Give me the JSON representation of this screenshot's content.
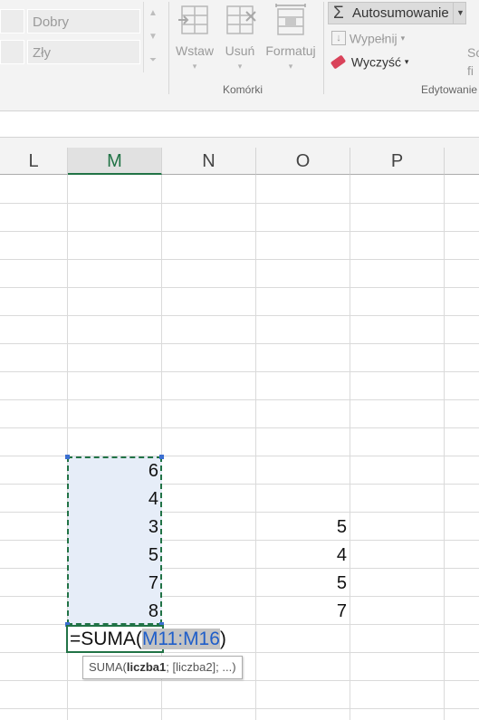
{
  "ribbon": {
    "styles": {
      "good": "Dobry",
      "bad": "Zły"
    },
    "cells_group": {
      "label": "Komórki",
      "buttons": [
        "Wstaw",
        "Usuń",
        "Formatuj"
      ]
    },
    "editing_group": {
      "label": "Edytowanie",
      "autosum": "Autosumowanie",
      "fill": "Wypełnij",
      "clear": "Wyczyść",
      "sort_partial": [
        "So",
        "fi"
      ]
    }
  },
  "grid": {
    "columns": [
      "L",
      "M",
      "N",
      "O",
      "P"
    ],
    "active_column": "M",
    "column_m_values": [
      "6",
      "4",
      "3",
      "5",
      "7",
      "8"
    ],
    "column_o_values": [
      "5",
      "4",
      "5",
      "7"
    ]
  },
  "formula": {
    "prefix": "=SUMA(",
    "range": "M11:M16",
    "suffix": ")"
  },
  "tooltip": {
    "func": "SUMA(",
    "arg1": "liczba1",
    "rest": "; [liczba2]; ...)"
  },
  "colors": {
    "accent_green": "#217346",
    "selection_fill": "#e6edf8",
    "reference_blue": "#1f5ec9"
  }
}
